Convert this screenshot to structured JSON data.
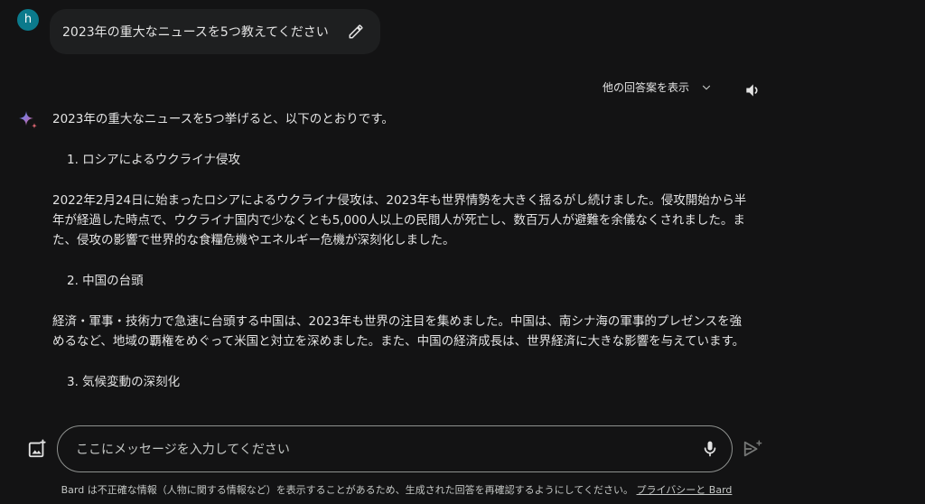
{
  "user": {
    "avatar_initial": "h",
    "prompt": "2023年の重大なニュースを5つ教えてください"
  },
  "response_header": {
    "drafts_label": "他の回答案を表示"
  },
  "response": {
    "intro": "2023年の重大なニュースを5つ挙げると、以下のとおりです。",
    "items": [
      {
        "heading": "1. ロシアによるウクライナ侵攻",
        "body": "2022年2月24日に始まったロシアによるウクライナ侵攻は、2023年も世界情勢を大きく揺るがし続けました。侵攻開始から半年が経過した時点で、ウクライナ国内で少なくとも5,000人以上の民間人が死亡し、数百万人が避難を余儀なくされました。また、侵攻の影響で世界的な食糧危機やエネルギー危機が深刻化しました。"
      },
      {
        "heading": "2. 中国の台頭",
        "body": "経済・軍事・技術力で急速に台頭する中国は、2023年も世界の注目を集めました。中国は、南シナ海の軍事的プレゼンスを強めるなど、地域の覇権をめぐって米国と対立を深めました。また、中国の経済成長は、世界経済に大きな影響を与えています。"
      },
      {
        "heading": "3. 気候変動の深刻化",
        "body": ""
      }
    ]
  },
  "input": {
    "placeholder": "ここにメッセージを入力してください"
  },
  "footer": {
    "disclaimer": "Bard は不正確な情報（人物に関する情報など）を表示することがあるため、生成された回答を再確認するようにしてください。",
    "privacy_link": "プライバシーと Bard"
  },
  "colors": {
    "background": "#131314",
    "bubble": "#1e1f20",
    "text": "#e3e3e3",
    "avatar": "#0b7a8c",
    "input_border": "#8e918f"
  }
}
